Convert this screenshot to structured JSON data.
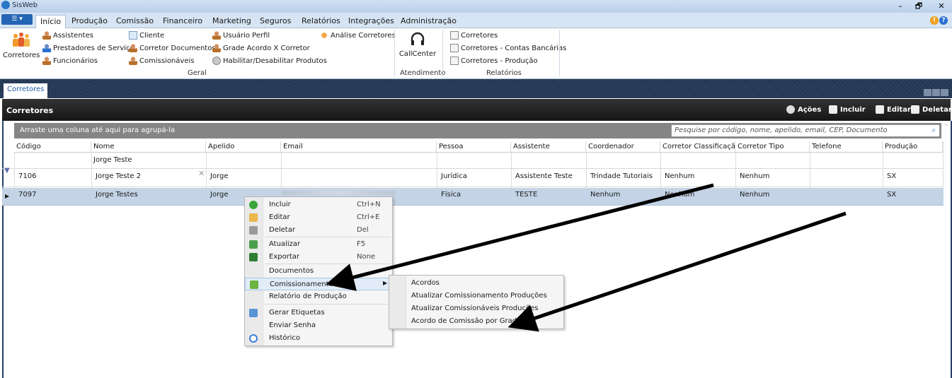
{
  "window": {
    "title": "SisWeb",
    "minimize": "–",
    "maximize": "🗗",
    "close": "✕"
  },
  "ribbon_tabs": [
    "Início",
    "Produção",
    "Comissão",
    "Financeiro",
    "Marketing",
    "Seguros",
    "Relatórios",
    "Integrações",
    "Administração"
  ],
  "ribbon": {
    "corretores_big": "Corretores",
    "geral": {
      "items": [
        "Assistentes",
        "Prestadores de Serviço",
        "Funcionários",
        "Cliente",
        "Corretor Documentos",
        "Comissionáveis",
        "Usuário Perfil",
        "Grade Acordo X Corretor",
        "Habilitar/Desabilitar Produtos",
        "Análise Corretores"
      ],
      "label": "Geral"
    },
    "atendimento": {
      "callcenter": "CallCenter",
      "label": "Atendimento"
    },
    "relatorios": {
      "items": [
        "Corretores",
        "Corretores - Contas Bancárias",
        "Corretores - Produção"
      ],
      "label": "Relatórios"
    }
  },
  "doc_tab": "Corretores",
  "panel": {
    "title": "Corretores",
    "actions": {
      "acoes": "Ações",
      "incluir": "Incluir",
      "editar": "Editar",
      "deletar": "Deletar"
    }
  },
  "group_hint": "Arraste uma coluna até aqui para agrupá-la",
  "search_placeholder": "Pesquise por código, nome, apelido, email, CEP, Documento",
  "grid": {
    "columns": [
      "Código",
      "Nome",
      "Apelido",
      "Email",
      "Pessoa",
      "Assistente",
      "Coordenador",
      "Corretor Classificação",
      "Corretor Tipo",
      "Telefone",
      "Produção"
    ],
    "filter": {
      "nome": "Jorge Teste"
    },
    "rows": [
      [
        "7106",
        "Jorge Teste 2",
        "Jorge",
        "",
        "Jurídica",
        "Assistente Teste",
        "Trindade Tutoriais",
        "Nenhum",
        "Nenhum",
        "",
        "SX"
      ],
      [
        "7097",
        "Jorge Testes",
        "Jorge",
        "",
        "Física",
        "TESTE",
        "Nenhum",
        "Nenhum",
        "Nenhum",
        "",
        "SX"
      ]
    ]
  },
  "context_menu": [
    {
      "label": "Incluir",
      "shortcut": "Ctrl+N"
    },
    {
      "label": "Editar",
      "shortcut": "Ctrl+E"
    },
    {
      "label": "Deletar",
      "shortcut": "Del"
    },
    {
      "label": "Atualizar",
      "shortcut": "F5"
    },
    {
      "label": "Exportar",
      "shortcut": "None"
    },
    {
      "label": "Documentos",
      "shortcut": ""
    },
    {
      "label": "Comissionamento",
      "shortcut": ""
    },
    {
      "label": "Relatório de Produção",
      "shortcut": ""
    },
    {
      "label": "Gerar Etiquetas",
      "shortcut": ""
    },
    {
      "label": "Enviar Senha",
      "shortcut": ""
    },
    {
      "label": "Histórico",
      "shortcut": ""
    }
  ],
  "submenu": [
    "Acordos",
    "Atualizar Comissionamento Produções",
    "Atualizar Comissionáveis Produções",
    "Acordo de Comissão por Grade"
  ],
  "colors": {
    "accent": "#2466b4",
    "dark_band": "#24364e",
    "selected_row": "#c4d4e6",
    "menu_highlight": "#e1ecf8"
  }
}
